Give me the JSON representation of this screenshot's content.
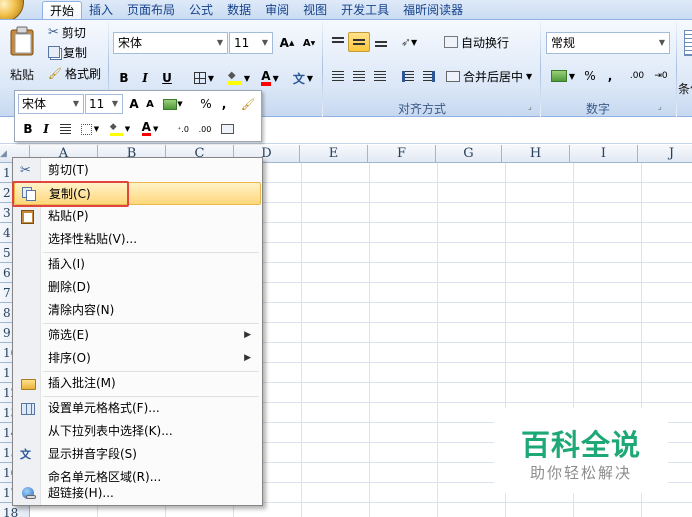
{
  "ribbon": {
    "tabs": [
      {
        "label": "开始",
        "active": true
      },
      {
        "label": "插入"
      },
      {
        "label": "页面布局"
      },
      {
        "label": "公式"
      },
      {
        "label": "数据"
      },
      {
        "label": "审阅"
      },
      {
        "label": "视图"
      },
      {
        "label": "开发工具"
      },
      {
        "label": "福昕阅读器"
      }
    ],
    "clipboard": {
      "paste": "粘贴",
      "cut": "剪切",
      "copy": "复制",
      "format_painter": "格式刷"
    },
    "font": {
      "name": "宋体",
      "size": "11",
      "bold": "B",
      "italic": "I",
      "underline": "U",
      "phonetic": "文"
    },
    "alignment": {
      "wrap_text": "自动换行",
      "merge_center": "合并后居中",
      "group_label": "对齐方式"
    },
    "number": {
      "format": "常规",
      "percent": "%",
      "comma": ",",
      "inc_decimal": ".00",
      "group_label": "数字"
    },
    "truncated_label": "条件"
  },
  "mini_toolbar": {
    "font_name": "宋体",
    "font_size": "11",
    "percent": "%",
    "comma": ",",
    "bold": "B",
    "italic": "I"
  },
  "columns": [
    "A",
    "B",
    "C",
    "D",
    "E",
    "F",
    "G",
    "H",
    "I",
    "J"
  ],
  "rows": [
    "1",
    "2",
    "3",
    "4",
    "5",
    "6",
    "7",
    "8",
    "9",
    "10",
    "11",
    "12",
    "13",
    "14",
    "15",
    "16",
    "17",
    "18"
  ],
  "context_menu": {
    "items": [
      {
        "label": "剪切(T)",
        "icon": "scissors-icon",
        "highlighted": false
      },
      {
        "label": "复制(C)",
        "icon": "copy-icon",
        "highlighted": true
      },
      {
        "label": "粘贴(P)",
        "icon": "paste-icon"
      },
      {
        "label": "选择性粘贴(V)..."
      },
      {
        "label": "插入(I)"
      },
      {
        "label": "删除(D)"
      },
      {
        "label": "清除内容(N)"
      },
      {
        "label": "筛选(E)",
        "submenu": true
      },
      {
        "label": "排序(O)",
        "submenu": true
      },
      {
        "label": "插入批注(M)",
        "icon": "comment-folder-icon"
      },
      {
        "label": "设置单元格格式(F)...",
        "icon": "format-cells-icon"
      },
      {
        "label": "从下拉列表中选择(K)..."
      },
      {
        "label": "显示拼音字段(S)",
        "icon": "phonetic-icon"
      },
      {
        "label": "命名单元格区域(R)..."
      },
      {
        "label": "超链接(H)...",
        "icon": "hyperlink-icon"
      }
    ]
  },
  "watermark": {
    "title": "百科全说",
    "subtitle": "助你轻松解决"
  },
  "colors": {
    "ribbon_bg": "#dbe7f7",
    "highlight_border": "#e0453f",
    "menu_hover": "#ffd77b",
    "watermark_green": "#1da876"
  }
}
